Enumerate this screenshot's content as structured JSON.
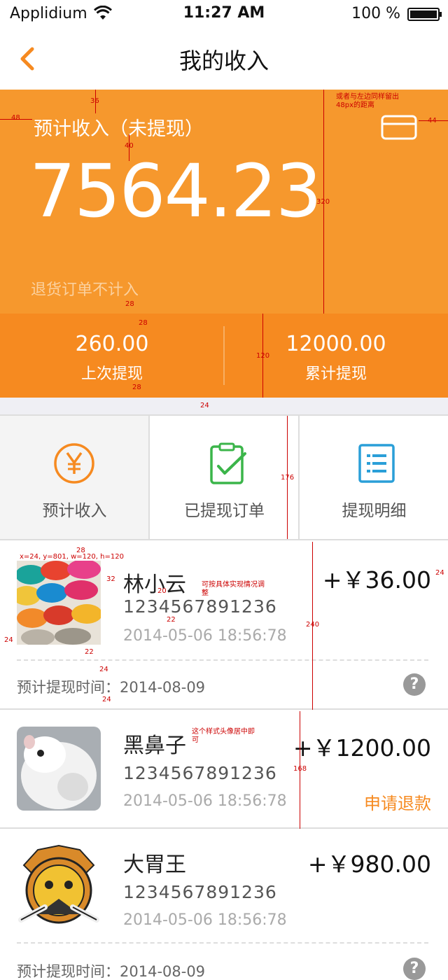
{
  "status_bar": {
    "carrier": "Applidium",
    "time": "11:27 AM",
    "battery": "100 %"
  },
  "nav": {
    "title": "我的收入",
    "back_icon": "chevron-left-icon"
  },
  "hero": {
    "label": "预计收入（未提现）",
    "amount": "7564.23",
    "note": "退货订单不计入",
    "card_icon": "card-icon"
  },
  "summary": {
    "last": {
      "value": "260.00",
      "label": "上次提现"
    },
    "total": {
      "value": "12000.00",
      "label": "累计提现"
    }
  },
  "tabs": [
    {
      "label": "预计收入",
      "icon": "yen-icon",
      "color": "#f68a20"
    },
    {
      "label": "已提现订单",
      "icon": "clipboard-check-icon",
      "color": "#3bb54a"
    },
    {
      "label": "提现明细",
      "icon": "list-icon",
      "color": "#2a9fd8"
    }
  ],
  "orders": [
    {
      "name": "林小云",
      "phone": "1234567891236",
      "datetime": "2014-05-06   18:56:78",
      "price": "+￥36.00",
      "estimate": "预计提现时间：2014-08-09"
    },
    {
      "name": "黑鼻子",
      "phone": "1234567891236",
      "datetime": "2014-05-06   18:56:78",
      "price": "+￥1200.00",
      "action": "申请退款"
    },
    {
      "name": "大胃王",
      "phone": "1234567891236",
      "datetime": "2014-05-06   18:56:78",
      "price": "+￥980.00",
      "estimate": "预计提现时间：2014-08-09"
    }
  ],
  "annotations": {
    "a36": "36",
    "a48": "48",
    "a40": "40",
    "a320": "320",
    "a44": "44",
    "side_note": "或者与左边同样留出48px的距离",
    "a28a": "28",
    "a28b": "28",
    "a28c": "28",
    "a120": "120",
    "a24": "24",
    "a176": "176",
    "a28d": "28",
    "avatar_box": "x=24, y=801, w=120, h=120",
    "a32": "32",
    "a20": "20",
    "a22a": "22",
    "a22b": "22",
    "a240": "240",
    "a24b": "24",
    "a24c": "24",
    "a24d": "24",
    "a24e": "24",
    "note_impl": "可按具体实现情况调整",
    "note_center": "这个样式头像居中即可",
    "a168": "168"
  },
  "colors": {
    "hero": "#f6982d",
    "summary": "#f68a20",
    "accent": "#f68a20"
  }
}
